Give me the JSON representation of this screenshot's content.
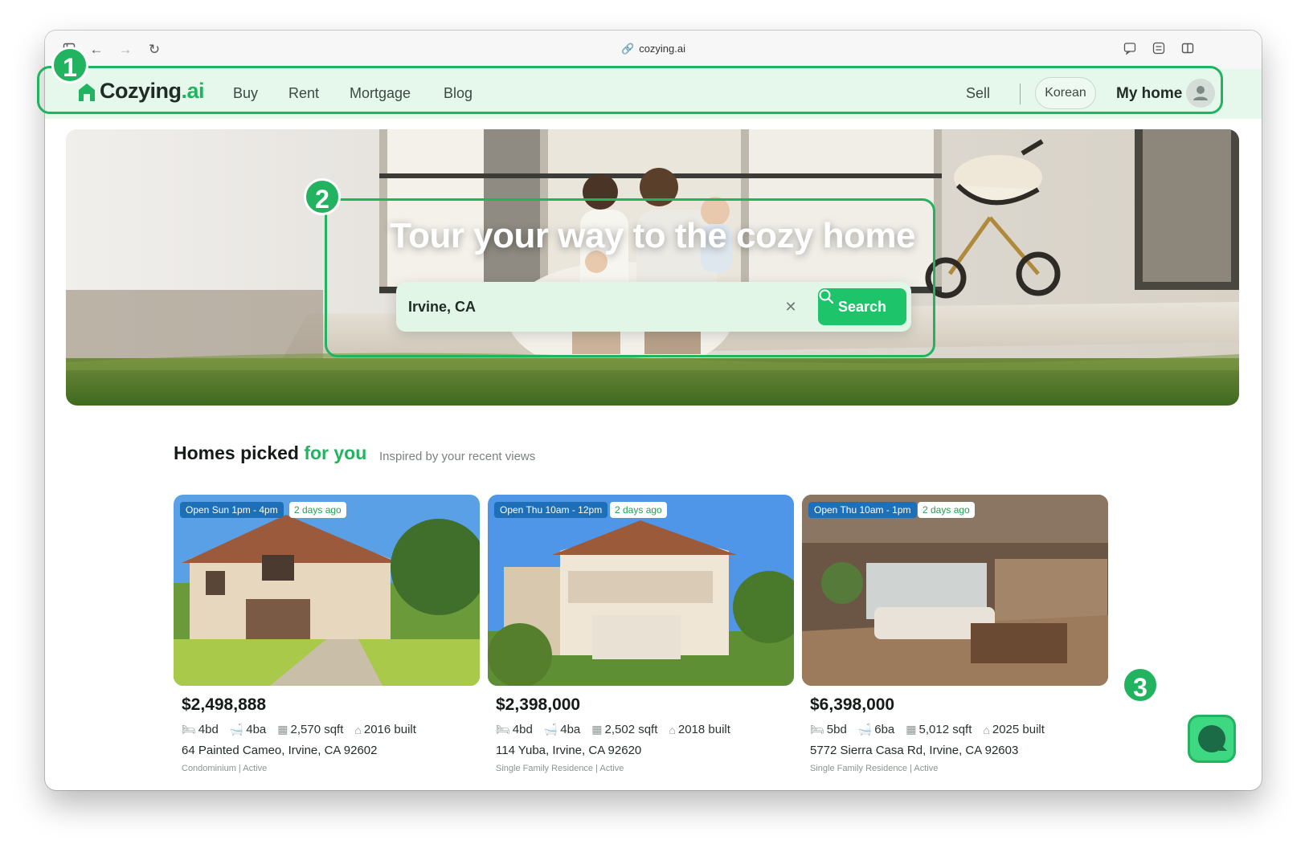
{
  "browser": {
    "url": "cozying.ai"
  },
  "nav": {
    "logo_main": "Cozying",
    "logo_suffix": ".ai",
    "links": [
      "Buy",
      "Rent",
      "Mortgage",
      "Blog"
    ],
    "sell": "Sell",
    "language": "Korean",
    "my_home": "My home"
  },
  "hero": {
    "title": "Tour your way to the cozy home",
    "search_value": "Irvine, CA",
    "search_button": "Search"
  },
  "section": {
    "title_main": "Homes picked",
    "title_accent": "for you",
    "subtitle": "Inspired by your recent views"
  },
  "listings": [
    {
      "open_house": "Open Sun 1pm - 4pm",
      "listed": "2 days ago",
      "price": "$2,498,888",
      "beds": "4bd",
      "baths": "4ba",
      "sqft": "2,570 sqft",
      "built": "2016 built",
      "address": "64 Painted Cameo, Irvine, CA 92602",
      "type": "Condominium | Active"
    },
    {
      "open_house": "Open Thu 10am - 12pm",
      "listed": "2 days ago",
      "price": "$2,398,000",
      "beds": "4bd",
      "baths": "4ba",
      "sqft": "2,502 sqft",
      "built": "2018 built",
      "address": "114 Yuba, Irvine, CA 92620",
      "type": "Single Family Residence | Active"
    },
    {
      "open_house": "Open Thu 10am - 1pm",
      "listed": "2 days ago",
      "price": "$6,398,000",
      "beds": "5bd",
      "baths": "6ba",
      "sqft": "5,012 sqft",
      "built": "2025 built",
      "address": "5772 Sierra Casa Rd, Irvine, CA 92603",
      "type": "Single Family Residence | Active"
    }
  ],
  "annotations": [
    "1",
    "2",
    "3"
  ],
  "colors": {
    "brand_green": "#21b35f",
    "nav_bg": "#e6f7ec",
    "open_tag": "#1d6fb8"
  }
}
